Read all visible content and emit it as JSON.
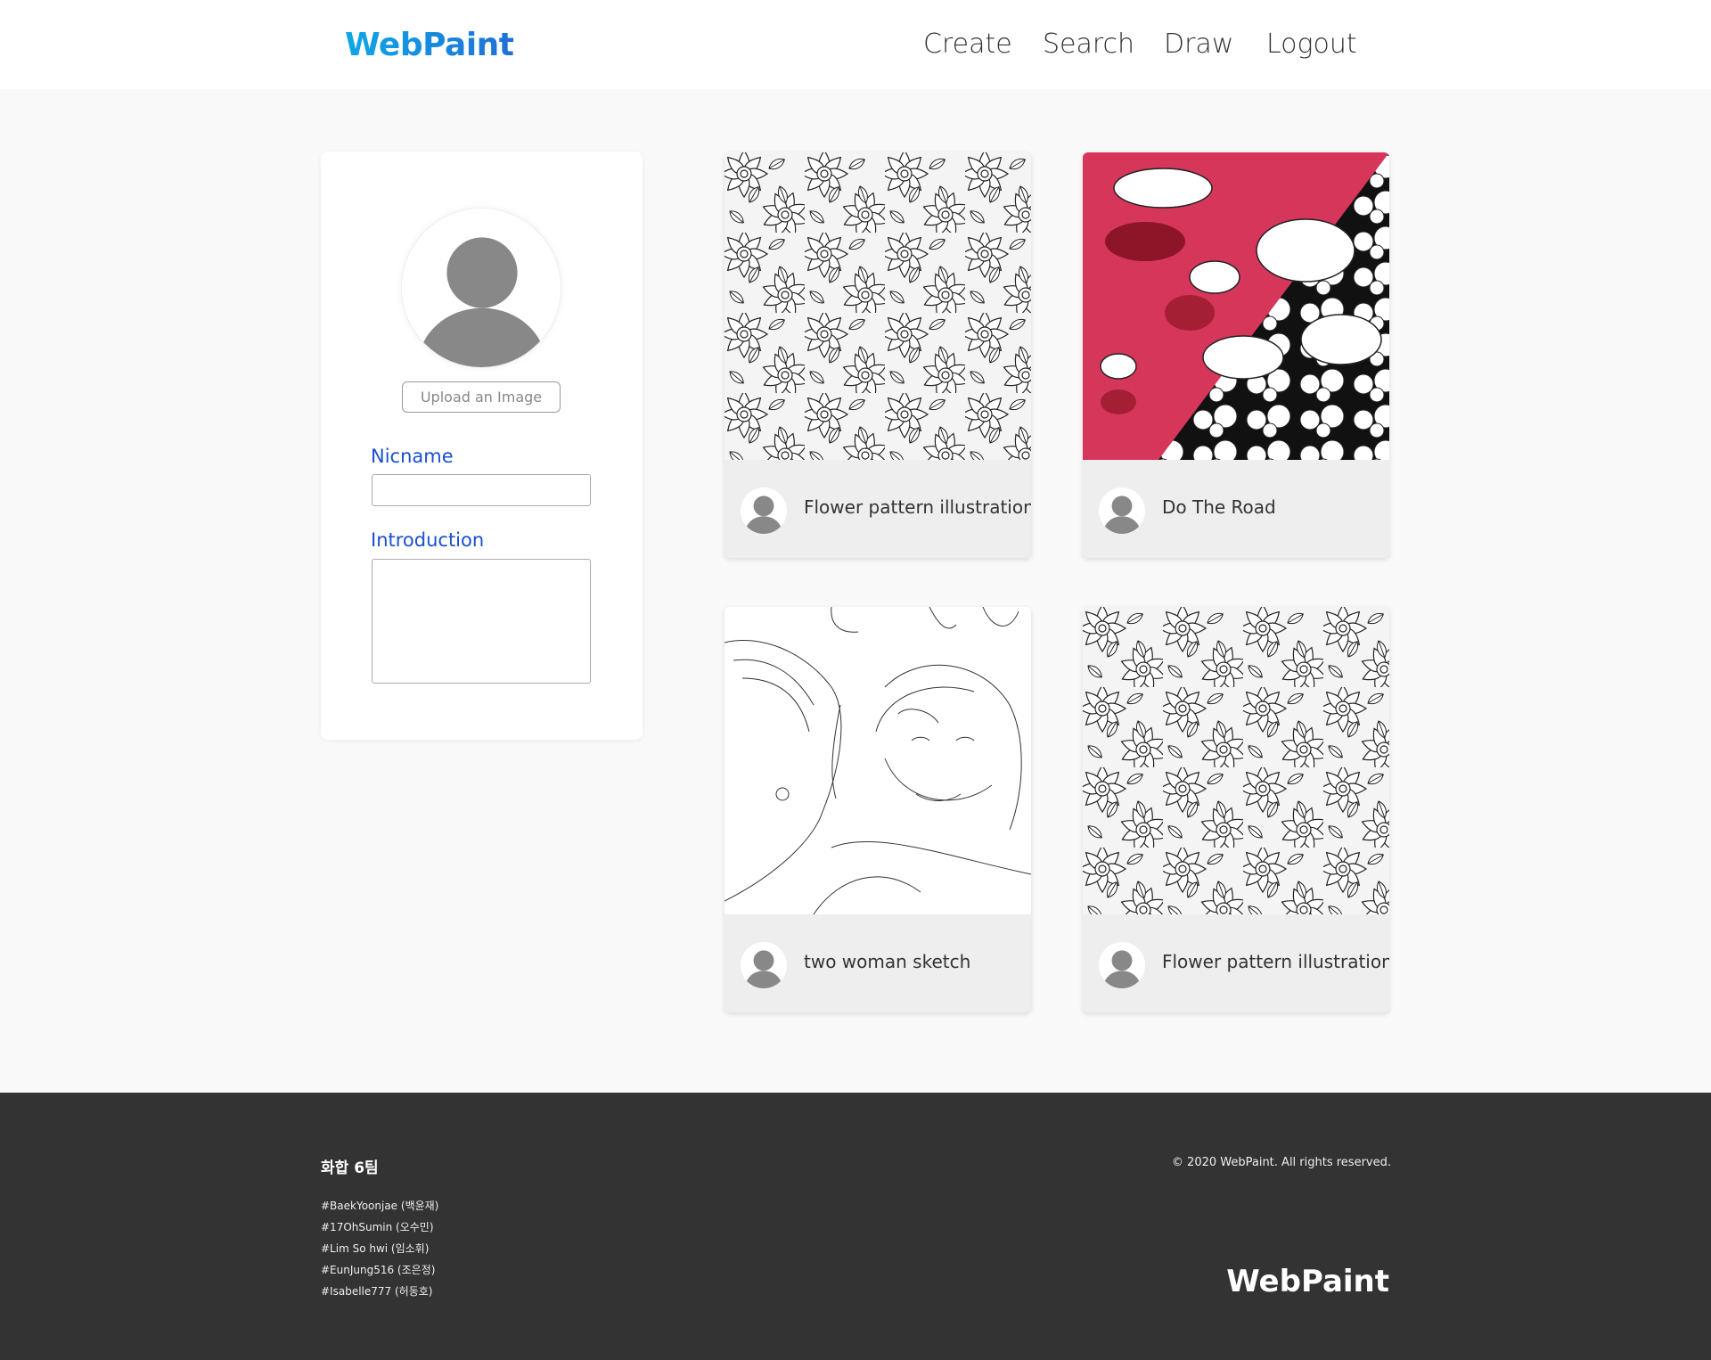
{
  "header": {
    "logo": "WebPaint",
    "nav": [
      "Create",
      "Search",
      "Draw",
      "Logout"
    ]
  },
  "profile": {
    "upload_label": "Upload an Image",
    "nickname_label": "Nicname",
    "nickname_value": "",
    "introduction_label": "Introduction",
    "introduction_value": ""
  },
  "gallery": [
    {
      "title": "Flower pattern illustration",
      "image": "flower-pattern"
    },
    {
      "title": "Do The Road",
      "image": "red-mural"
    },
    {
      "title": "two woman sketch",
      "image": "women-sketch"
    },
    {
      "title": "Flower pattern illustration",
      "image": "flower-pattern"
    }
  ],
  "footer": {
    "team": "화합 6팀",
    "members": [
      "#BaekYoonjae (백윤재)",
      "#17OhSumin (오수민)",
      "#Lim So hwi (임소휘)",
      "#EunJung516 (조은정)",
      "#Isabelle777 (허동호)"
    ],
    "copyright": "© 2020 WebPaint. All rights reserved.",
    "logo": "WebPaint"
  },
  "colors": {
    "accent": "#1a4fd0",
    "logo_gradient": [
      "#0fa8e6",
      "#1f6fd6"
    ],
    "footer_bg": "#333333",
    "page_bg": "#f9f9f9",
    "mural_red": "#d6365a"
  }
}
